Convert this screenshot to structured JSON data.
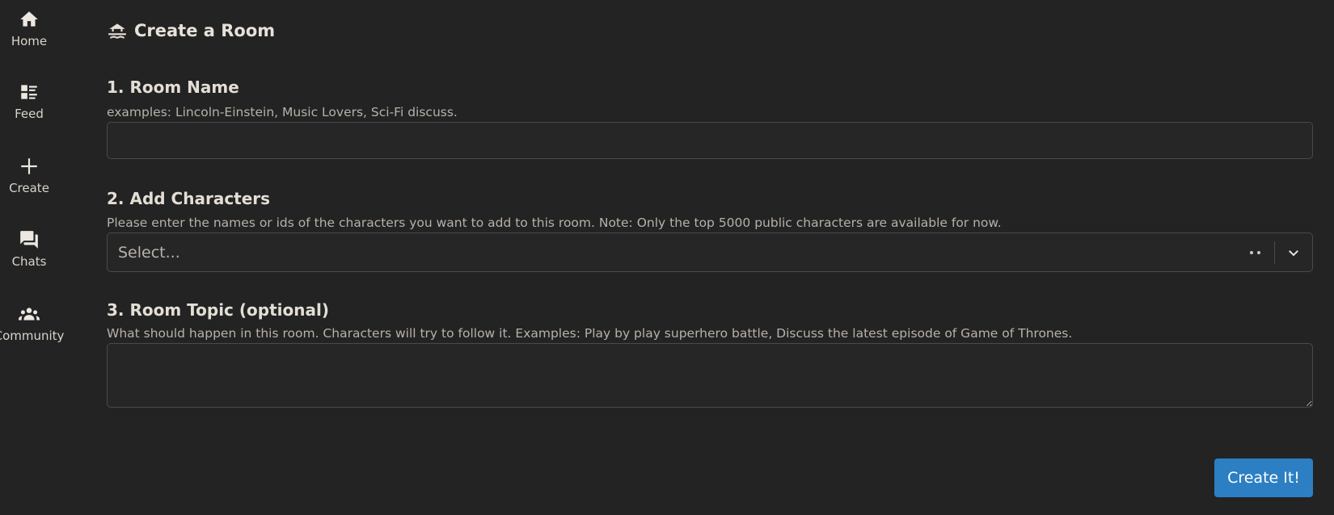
{
  "sidebar": {
    "items": [
      {
        "label": "Home",
        "icon": "home-icon"
      },
      {
        "label": "Feed",
        "icon": "feed-icon"
      },
      {
        "label": "Create",
        "icon": "plus-icon"
      },
      {
        "label": "Chats",
        "icon": "chat-bubbles-icon"
      },
      {
        "label": "Community",
        "icon": "people-icon"
      }
    ]
  },
  "page": {
    "title": "Create a Room",
    "title_icon": "room-icon"
  },
  "form": {
    "room_name": {
      "title": "1. Room Name",
      "hint": "examples: Lincoln-Einstein, Music Lovers, Sci-Fi discuss.",
      "value": ""
    },
    "characters": {
      "title": "2. Add Characters",
      "hint": "Please enter the names or ids of the characters you want to add to this room. Note: Only the top 5000 public characters are available for now.",
      "placeholder": "Select..."
    },
    "topic": {
      "title": "3. Room Topic (optional)",
      "hint": "What should happen in this room. Characters will try to follow it. Examples: Play by play superhero battle, Discuss the latest episode of Game of Thrones.",
      "value": ""
    },
    "submit_label": "Create It!"
  },
  "colors": {
    "background": "#232323",
    "accent": "#2c7fc2",
    "text": "#d9d4cc"
  }
}
